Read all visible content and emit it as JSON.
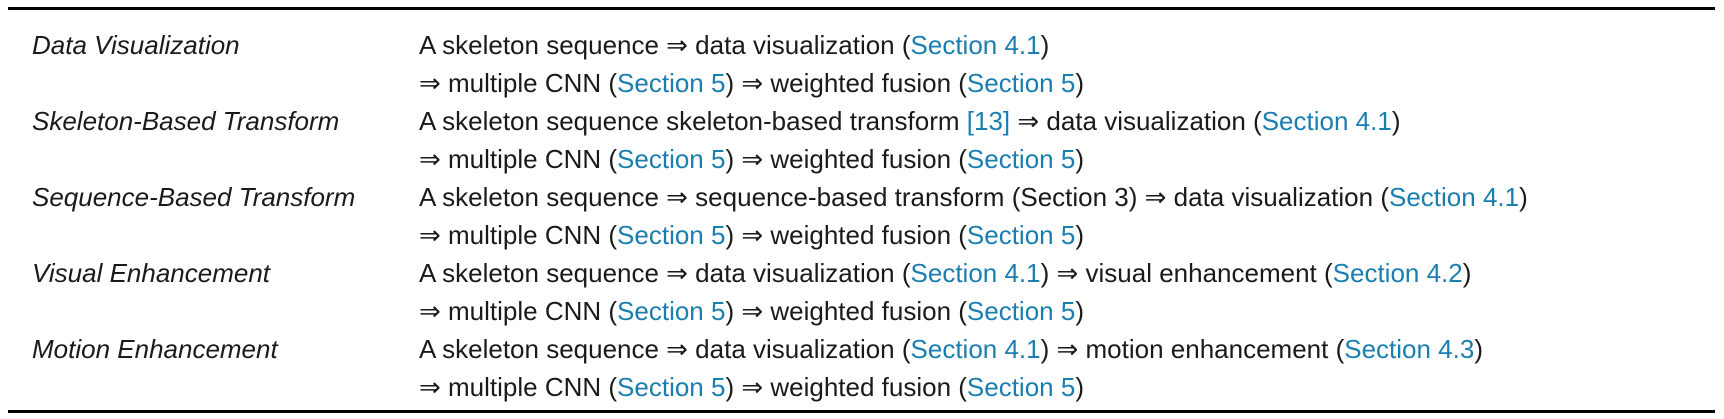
{
  "table": {
    "rows": [
      {
        "name": "Data Visualization",
        "line1": [
          {
            "t": "A skeleton sequence ⇒ data visualization ("
          },
          {
            "t": "Section 4.1",
            "ref": true
          },
          {
            "t": ")"
          }
        ],
        "line2": [
          {
            "t": "⇒ multiple CNN ("
          },
          {
            "t": "Section 5",
            "ref": true
          },
          {
            "t": ") ⇒ weighted fusion ("
          },
          {
            "t": "Section 5",
            "ref": true
          },
          {
            "t": ")"
          }
        ]
      },
      {
        "name": "Skeleton-Based Transform",
        "line1": [
          {
            "t": "A skeleton sequence skeleton-based transform "
          },
          {
            "t": "[13]",
            "ref": true
          },
          {
            "t": " ⇒ data visualization ("
          },
          {
            "t": "Section 4.1",
            "ref": true
          },
          {
            "t": ")"
          }
        ],
        "line2": [
          {
            "t": "⇒ multiple CNN ("
          },
          {
            "t": "Section 5",
            "ref": true
          },
          {
            "t": ") ⇒ weighted fusion ("
          },
          {
            "t": "Section 5",
            "ref": true
          },
          {
            "t": ")"
          }
        ]
      },
      {
        "name": "Sequence-Based Transform",
        "line1": [
          {
            "t": "A skeleton sequence ⇒ sequence-based transform (Section 3) ⇒ data visualization ("
          },
          {
            "t": "Section 4.1",
            "ref": true
          },
          {
            "t": ")"
          }
        ],
        "line2": [
          {
            "t": "⇒ multiple CNN ("
          },
          {
            "t": "Section 5",
            "ref": true
          },
          {
            "t": ") ⇒ weighted fusion ("
          },
          {
            "t": "Section 5",
            "ref": true
          },
          {
            "t": ")"
          }
        ]
      },
      {
        "name": "Visual Enhancement",
        "line1": [
          {
            "t": "A skeleton sequence ⇒ data visualization ("
          },
          {
            "t": "Section 4.1",
            "ref": true
          },
          {
            "t": ") ⇒ visual enhancement ("
          },
          {
            "t": "Section 4.2",
            "ref": true
          },
          {
            "t": ")"
          }
        ],
        "line2": [
          {
            "t": "⇒ multiple CNN ("
          },
          {
            "t": "Section 5",
            "ref": true
          },
          {
            "t": ") ⇒ weighted fusion ("
          },
          {
            "t": "Section 5",
            "ref": true
          },
          {
            "t": ")"
          }
        ]
      },
      {
        "name": "Motion Enhancement",
        "line1": [
          {
            "t": "A skeleton sequence ⇒ data visualization ("
          },
          {
            "t": "Section 4.1",
            "ref": true
          },
          {
            "t": ") ⇒ motion enhancement ("
          },
          {
            "t": "Section 4.3",
            "ref": true
          },
          {
            "t": ")"
          }
        ],
        "line2": [
          {
            "t": "⇒ multiple CNN ("
          },
          {
            "t": "Section 5",
            "ref": true
          },
          {
            "t": ") ⇒ weighted fusion ("
          },
          {
            "t": "Section 5",
            "ref": true
          },
          {
            "t": ")"
          }
        ]
      }
    ]
  },
  "colors": {
    "link": "#1a7fb0",
    "text": "#1a1a1a",
    "rule": "#000000"
  }
}
